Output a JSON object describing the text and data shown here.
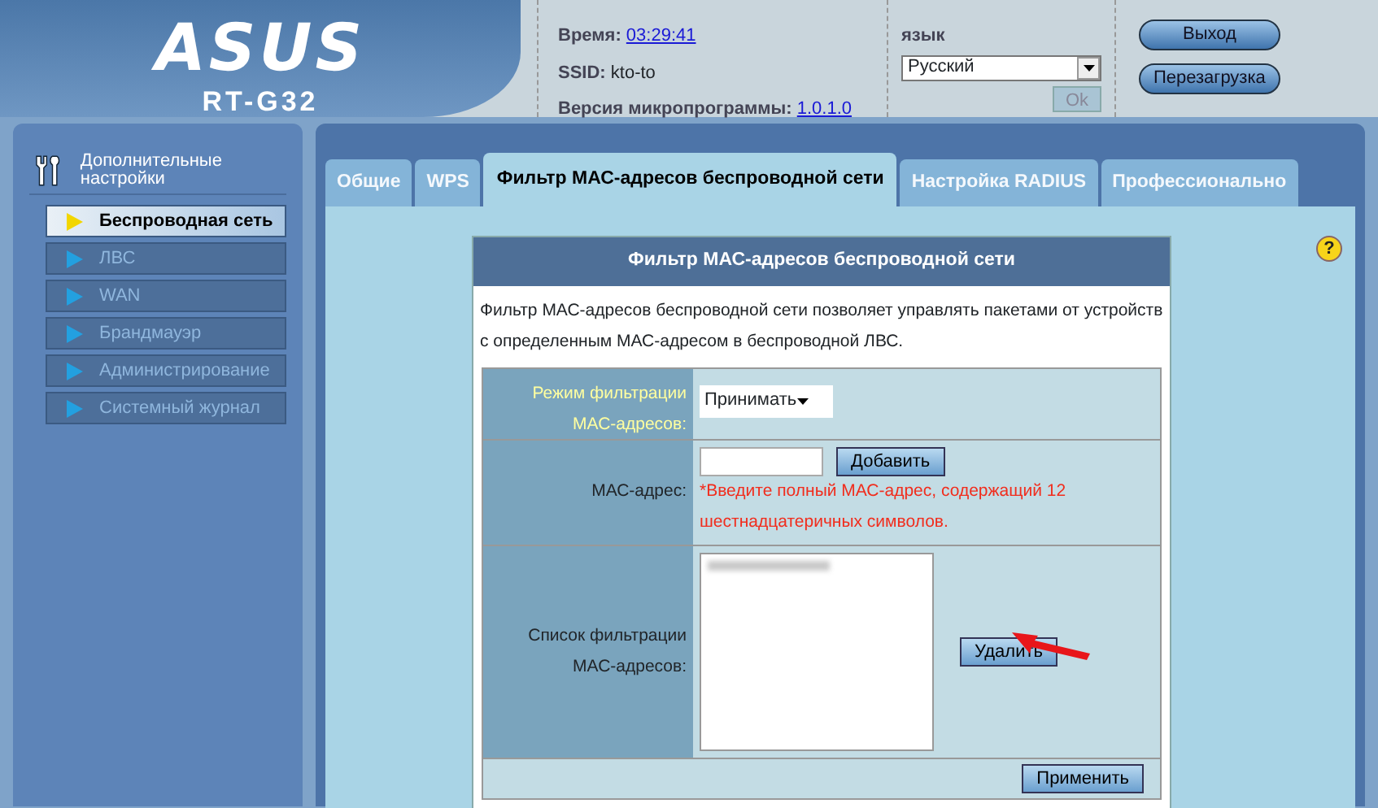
{
  "header": {
    "logo": "ASUS",
    "model": "RT-G32",
    "info": [
      {
        "label": "Время:",
        "value": "03:29:41",
        "link": true
      },
      {
        "label": "SSID:",
        "value": "kto-to",
        "link": false
      },
      {
        "label": "Версия микропрограммы:",
        "value": "1.0.1.0",
        "link": true
      }
    ],
    "language": {
      "label": "язык",
      "value": "Русский",
      "ok": "Ok",
      "ok_disabled": true
    },
    "buttons": [
      "Выход",
      "Перезагрузка"
    ]
  },
  "sidebar": {
    "title": "Дополнительные настройки",
    "items": [
      {
        "label": "Беспроводная сеть",
        "selected": true
      },
      {
        "label": "ЛВС",
        "selected": false
      },
      {
        "label": "WAN",
        "selected": false
      },
      {
        "label": "Брандмауэр",
        "selected": false
      },
      {
        "label": "Администрирование",
        "selected": false
      },
      {
        "label": "Системный журнал",
        "selected": false
      }
    ]
  },
  "tabs": [
    {
      "label": "Общие",
      "selected": false
    },
    {
      "label": "WPS",
      "selected": false
    },
    {
      "label": "Фильтр МАС-адресов беспроводной сети",
      "selected": true
    },
    {
      "label": "Настройка RADIUS",
      "selected": false
    },
    {
      "label": "Профессионально",
      "selected": false
    }
  ],
  "help": "?",
  "panel": {
    "title": "Фильтр МАС-адресов беспроводной сети",
    "description": "Фильтр МАС-адресов беспроводной сети позволяет управлять пакетами от устройств с определенным МАС-адресом в беспроводной ЛВС.",
    "rows": [
      {
        "kind": "select",
        "label": "Режим фильтрации МАС-адресов:",
        "help_link": true,
        "value": "Принимать"
      },
      {
        "kind": "input",
        "label": "МАС-адрес:",
        "help_link": false,
        "button": "Добавить",
        "hint": "*Введите полный МАС-адрес, содержащий 12 шестнадцатеричных символов."
      },
      {
        "kind": "list",
        "label": "Список фильтрации МАС-адресов:",
        "help_link": false,
        "button": "Удалить"
      }
    ],
    "apply": "Применить"
  }
}
